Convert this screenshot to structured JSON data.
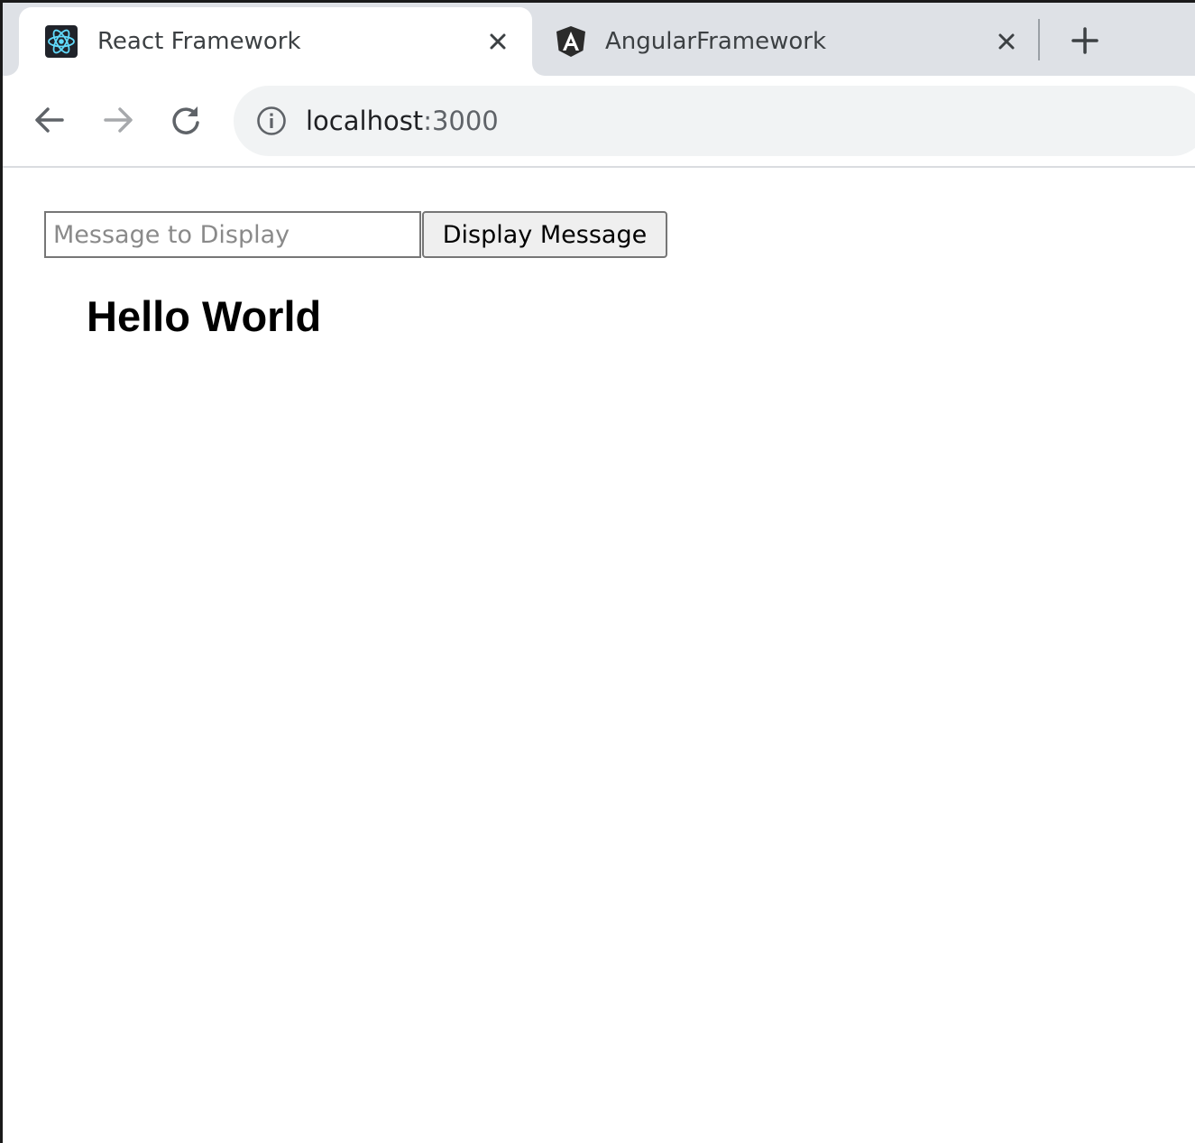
{
  "browser": {
    "tabs": [
      {
        "title": "React Framework",
        "favicon": "react-atom-icon",
        "active": true
      },
      {
        "title": "AngularFramework",
        "favicon": "angular-shield-icon",
        "active": false
      }
    ],
    "new_tab_icon": "plus-icon",
    "toolbar": {
      "back_icon": "arrow-left-icon",
      "forward_icon": "arrow-right-icon",
      "reload_icon": "reload-icon",
      "site_info_icon": "info-circle-icon",
      "url_host": "localhost",
      "url_port": ":3000"
    }
  },
  "page": {
    "message_input": {
      "value": "",
      "placeholder": "Message to Display"
    },
    "display_button_label": "Display Message",
    "heading": "Hello World"
  },
  "colors": {
    "tabstrip_bg": "#dee1e6",
    "omnibox_bg": "#f1f3f4",
    "react_blue": "#61dafb",
    "angular_dark": "#2b2b2b"
  }
}
